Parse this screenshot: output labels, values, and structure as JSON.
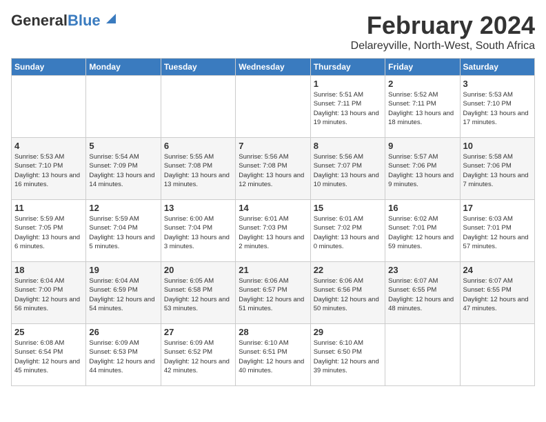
{
  "header": {
    "logo_general": "General",
    "logo_blue": "Blue",
    "month": "February 2024",
    "location": "Delareyville, North-West, South Africa"
  },
  "weekdays": [
    "Sunday",
    "Monday",
    "Tuesday",
    "Wednesday",
    "Thursday",
    "Friday",
    "Saturday"
  ],
  "weeks": [
    [
      {
        "day": "",
        "info": ""
      },
      {
        "day": "",
        "info": ""
      },
      {
        "day": "",
        "info": ""
      },
      {
        "day": "",
        "info": ""
      },
      {
        "day": "1",
        "info": "Sunrise: 5:51 AM\nSunset: 7:11 PM\nDaylight: 13 hours and 19 minutes."
      },
      {
        "day": "2",
        "info": "Sunrise: 5:52 AM\nSunset: 7:11 PM\nDaylight: 13 hours and 18 minutes."
      },
      {
        "day": "3",
        "info": "Sunrise: 5:53 AM\nSunset: 7:10 PM\nDaylight: 13 hours and 17 minutes."
      }
    ],
    [
      {
        "day": "4",
        "info": "Sunrise: 5:53 AM\nSunset: 7:10 PM\nDaylight: 13 hours and 16 minutes."
      },
      {
        "day": "5",
        "info": "Sunrise: 5:54 AM\nSunset: 7:09 PM\nDaylight: 13 hours and 14 minutes."
      },
      {
        "day": "6",
        "info": "Sunrise: 5:55 AM\nSunset: 7:08 PM\nDaylight: 13 hours and 13 minutes."
      },
      {
        "day": "7",
        "info": "Sunrise: 5:56 AM\nSunset: 7:08 PM\nDaylight: 13 hours and 12 minutes."
      },
      {
        "day": "8",
        "info": "Sunrise: 5:56 AM\nSunset: 7:07 PM\nDaylight: 13 hours and 10 minutes."
      },
      {
        "day": "9",
        "info": "Sunrise: 5:57 AM\nSunset: 7:06 PM\nDaylight: 13 hours and 9 minutes."
      },
      {
        "day": "10",
        "info": "Sunrise: 5:58 AM\nSunset: 7:06 PM\nDaylight: 13 hours and 7 minutes."
      }
    ],
    [
      {
        "day": "11",
        "info": "Sunrise: 5:59 AM\nSunset: 7:05 PM\nDaylight: 13 hours and 6 minutes."
      },
      {
        "day": "12",
        "info": "Sunrise: 5:59 AM\nSunset: 7:04 PM\nDaylight: 13 hours and 5 minutes."
      },
      {
        "day": "13",
        "info": "Sunrise: 6:00 AM\nSunset: 7:04 PM\nDaylight: 13 hours and 3 minutes."
      },
      {
        "day": "14",
        "info": "Sunrise: 6:01 AM\nSunset: 7:03 PM\nDaylight: 13 hours and 2 minutes."
      },
      {
        "day": "15",
        "info": "Sunrise: 6:01 AM\nSunset: 7:02 PM\nDaylight: 13 hours and 0 minutes."
      },
      {
        "day": "16",
        "info": "Sunrise: 6:02 AM\nSunset: 7:01 PM\nDaylight: 12 hours and 59 minutes."
      },
      {
        "day": "17",
        "info": "Sunrise: 6:03 AM\nSunset: 7:01 PM\nDaylight: 12 hours and 57 minutes."
      }
    ],
    [
      {
        "day": "18",
        "info": "Sunrise: 6:04 AM\nSunset: 7:00 PM\nDaylight: 12 hours and 56 minutes."
      },
      {
        "day": "19",
        "info": "Sunrise: 6:04 AM\nSunset: 6:59 PM\nDaylight: 12 hours and 54 minutes."
      },
      {
        "day": "20",
        "info": "Sunrise: 6:05 AM\nSunset: 6:58 PM\nDaylight: 12 hours and 53 minutes."
      },
      {
        "day": "21",
        "info": "Sunrise: 6:06 AM\nSunset: 6:57 PM\nDaylight: 12 hours and 51 minutes."
      },
      {
        "day": "22",
        "info": "Sunrise: 6:06 AM\nSunset: 6:56 PM\nDaylight: 12 hours and 50 minutes."
      },
      {
        "day": "23",
        "info": "Sunrise: 6:07 AM\nSunset: 6:55 PM\nDaylight: 12 hours and 48 minutes."
      },
      {
        "day": "24",
        "info": "Sunrise: 6:07 AM\nSunset: 6:55 PM\nDaylight: 12 hours and 47 minutes."
      }
    ],
    [
      {
        "day": "25",
        "info": "Sunrise: 6:08 AM\nSunset: 6:54 PM\nDaylight: 12 hours and 45 minutes."
      },
      {
        "day": "26",
        "info": "Sunrise: 6:09 AM\nSunset: 6:53 PM\nDaylight: 12 hours and 44 minutes."
      },
      {
        "day": "27",
        "info": "Sunrise: 6:09 AM\nSunset: 6:52 PM\nDaylight: 12 hours and 42 minutes."
      },
      {
        "day": "28",
        "info": "Sunrise: 6:10 AM\nSunset: 6:51 PM\nDaylight: 12 hours and 40 minutes."
      },
      {
        "day": "29",
        "info": "Sunrise: 6:10 AM\nSunset: 6:50 PM\nDaylight: 12 hours and 39 minutes."
      },
      {
        "day": "",
        "info": ""
      },
      {
        "day": "",
        "info": ""
      }
    ]
  ]
}
